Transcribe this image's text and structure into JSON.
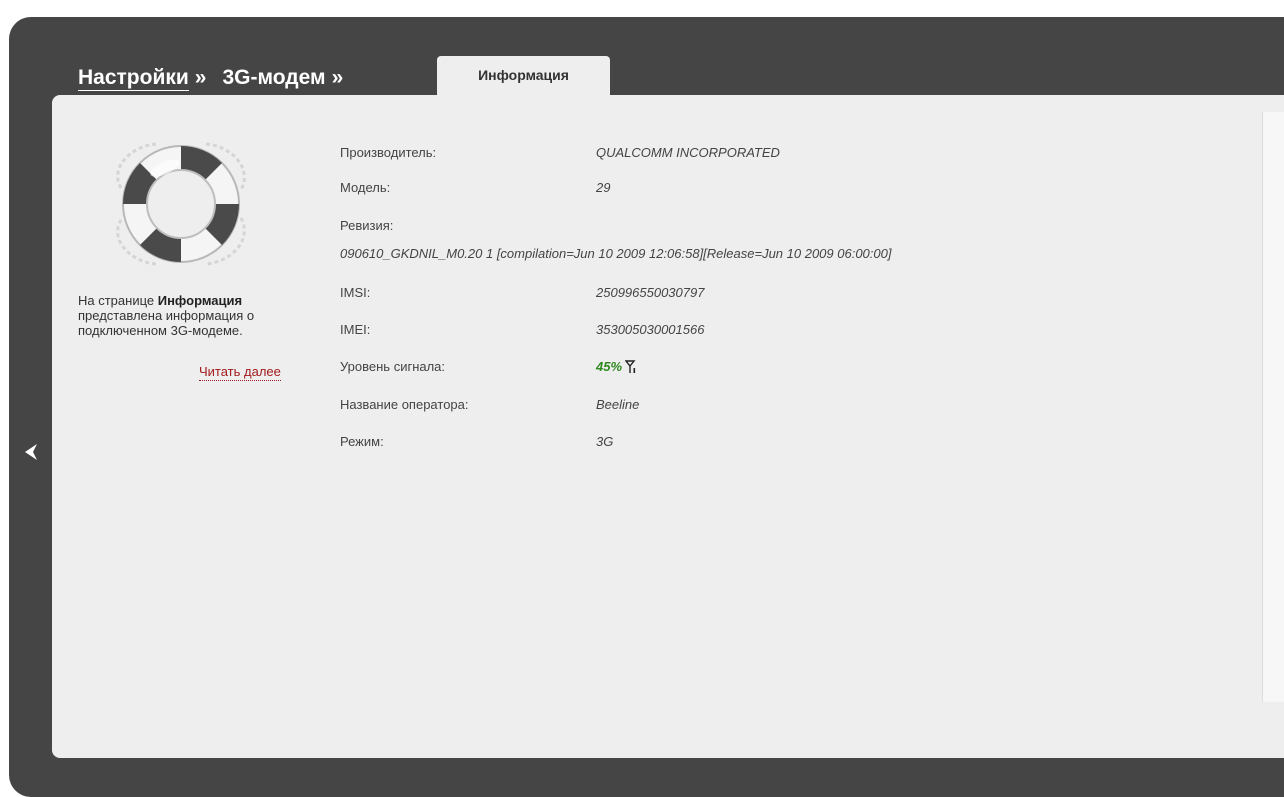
{
  "breadcrumb": {
    "level1": "Настройки",
    "sep1": "»",
    "level2": "3G-модем",
    "sep2": "»",
    "active_tab": "Информация"
  },
  "sidebar": {
    "help_prefix": "На странице ",
    "help_bold": "Информация",
    "help_suffix": " представлена информация о подключенном 3G-модеме.",
    "read_more": "Читать далее"
  },
  "info": {
    "manufacturer_label": "Производитель:",
    "manufacturer_value": "QUALCOMM INCORPORATED",
    "model_label": "Модель:",
    "model_value": "29",
    "revision_label": "Ревизия:",
    "revision_value": "090610_GKDNIL_M0.20 1 [compilation=Jun 10 2009 12:06:58][Release=Jun 10 2009 06:00:00]",
    "imsi_label": "IMSI:",
    "imsi_value": "250996550030797",
    "imei_label": "IMEI:",
    "imei_value": "353005030001566",
    "signal_label": "Уровень сигнала:",
    "signal_value": "45%",
    "operator_label": "Название оператора:",
    "operator_value": "Beeline",
    "mode_label": "Режим:",
    "mode_value": "3G"
  },
  "icons": {
    "collapse": "chevron-left-icon",
    "help_image": "lifebuoy-icon",
    "signal": "antenna-icon"
  },
  "colors": {
    "frame": "#454545",
    "panel": "#eeeeee",
    "link": "#a31b1b",
    "signal": "#2f8a1f"
  }
}
